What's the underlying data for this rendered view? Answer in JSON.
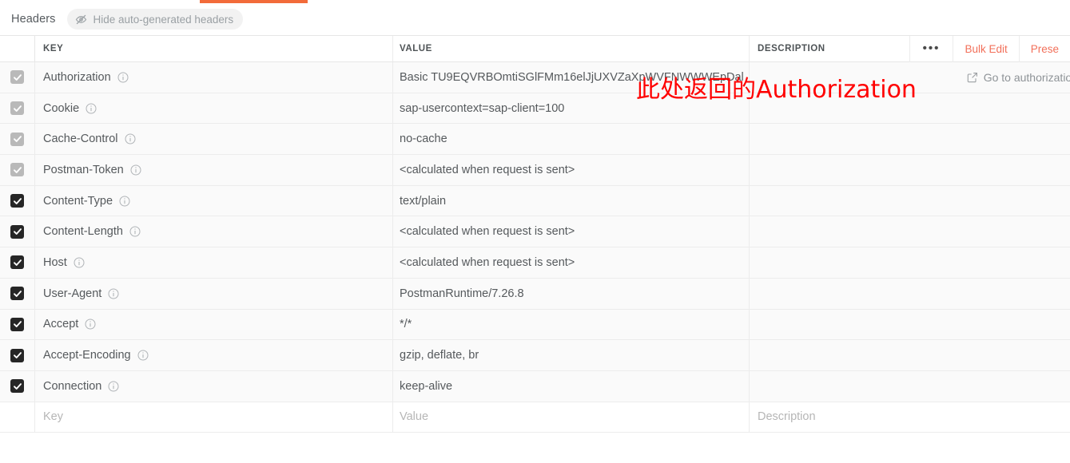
{
  "tab": {
    "accent_color": "#f26b3a"
  },
  "toolbar": {
    "title": "Headers",
    "hide_toggle_label": "Hide auto-generated headers",
    "hide_toggle_icon": "eye-off-icon"
  },
  "table": {
    "columns": {
      "key": "KEY",
      "value": "VALUE",
      "description": "DESCRIPTION"
    },
    "actions": {
      "more_label": "•••",
      "bulk_edit_label": "Bulk Edit",
      "presets_label": "Prese",
      "accent_color": "#f2705a"
    },
    "rows": [
      {
        "checked": true,
        "auto": true,
        "key": "Authorization",
        "value": "Basic TU9EQVRBOmtiSGlFMm16elJjUXVZaXpWVFNWWWEpDal",
        "description": ""
      },
      {
        "checked": true,
        "auto": true,
        "key": "Cookie",
        "value": "sap-usercontext=sap-client=100",
        "description": ""
      },
      {
        "checked": true,
        "auto": true,
        "key": "Cache-Control",
        "value": "no-cache",
        "description": ""
      },
      {
        "checked": true,
        "auto": true,
        "key": "Postman-Token",
        "value": "<calculated when request is sent>",
        "description": ""
      },
      {
        "checked": true,
        "auto": false,
        "key": "Content-Type",
        "value": "text/plain",
        "description": ""
      },
      {
        "checked": true,
        "auto": false,
        "key": "Content-Length",
        "value": "<calculated when request is sent>",
        "description": ""
      },
      {
        "checked": true,
        "auto": false,
        "key": "Host",
        "value": "<calculated when request is sent>",
        "description": ""
      },
      {
        "checked": true,
        "auto": false,
        "key": "User-Agent",
        "value": "PostmanRuntime/7.26.8",
        "description": ""
      },
      {
        "checked": true,
        "auto": false,
        "key": "Accept",
        "value": "*/*",
        "description": ""
      },
      {
        "checked": true,
        "auto": false,
        "key": "Accept-Encoding",
        "value": "gzip, deflate, br",
        "description": ""
      },
      {
        "checked": true,
        "auto": false,
        "key": "Connection",
        "value": "keep-alive",
        "description": ""
      }
    ],
    "placeholder_row": {
      "key": "Key",
      "value": "Value",
      "description": "Description"
    },
    "goto_auth": {
      "label": "Go to authorization",
      "icon": "external-link-icon"
    }
  },
  "annotation": {
    "text": "此处返回的Authorization",
    "color": "#ff0000"
  }
}
